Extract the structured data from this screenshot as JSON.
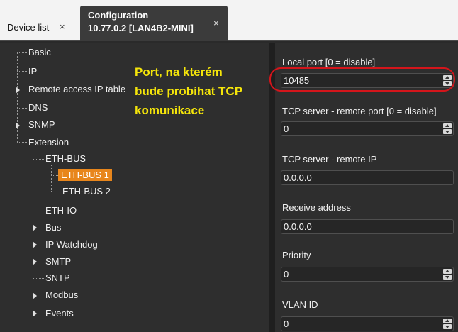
{
  "tabs": {
    "device_list": "Device list",
    "close_glyph": "×",
    "config_title": "Configuration",
    "config_subtitle": "10.77.0.2 [LAN4B2-MINI]"
  },
  "tree": {
    "basic": "Basic",
    "ip": "IP",
    "remote_access": "Remote access IP table",
    "dns": "DNS",
    "snmp": "SNMP",
    "extension": "Extension",
    "eth_bus": "ETH-BUS",
    "eth_bus_1": "ETH-BUS 1",
    "eth_bus_2": "ETH-BUS 2",
    "eth_io": "ETH-IO",
    "bus": "Bus",
    "ip_watchdog": "IP Watchdog",
    "smtp": "SMTP",
    "sntp": "SNTP",
    "modbus": "Modbus",
    "events": "Events"
  },
  "annotation": {
    "line1": "Port, na kterém",
    "line2": "bude probíhat TCP",
    "line3": "komunikace"
  },
  "form": {
    "local_port_label": "Local port [0 = disable]",
    "local_port_value": "10485",
    "tcp_remote_port_label": "TCP server - remote port [0 = disable]",
    "tcp_remote_port_value": "0",
    "tcp_remote_ip_label": "TCP server - remote IP",
    "tcp_remote_ip_value": "0.0.0.0",
    "receive_address_label": "Receive address",
    "receive_address_value": "0.0.0.0",
    "priority_label": "Priority",
    "priority_value": "0",
    "vlan_label": "VLAN ID",
    "vlan_value": "0"
  },
  "colors": {
    "selected_bg": "#e8861c",
    "annotation": "#f5e50a",
    "highlight_ring": "#d4151b"
  }
}
